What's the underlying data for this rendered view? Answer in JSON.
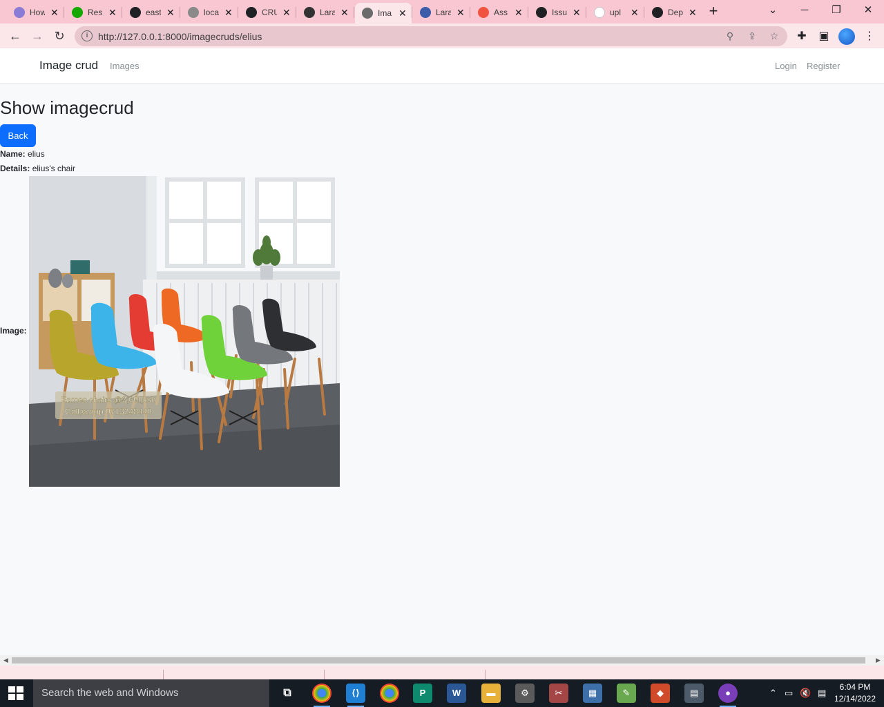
{
  "browser": {
    "tabs": [
      {
        "title": "How",
        "favicon_color": "#8a7bd6"
      },
      {
        "title": "Res",
        "favicon_color": "#14a800"
      },
      {
        "title": "east",
        "favicon_color": "#202124"
      },
      {
        "title": "loca",
        "favicon_color": "#8a8a8a"
      },
      {
        "title": "CRU",
        "favicon_color": "#202124"
      },
      {
        "title": "Lara",
        "favicon_color": "#333333"
      },
      {
        "title": "Ima",
        "favicon_color": "#6b6b6b"
      },
      {
        "title": "Lara",
        "favicon_color": "#3c5ba8"
      },
      {
        "title": "Ass",
        "favicon_color": "#f05340"
      },
      {
        "title": "Issu",
        "favicon_color": "#202124"
      },
      {
        "title": "upl",
        "favicon_color": "#ffffff"
      },
      {
        "title": "Dep",
        "favicon_color": "#202124"
      }
    ],
    "active_tab_index": 6,
    "url": "http://127.0.0.1:8000/imagecruds/elius",
    "colors": {
      "tabstrip": "#f9c7d2",
      "toolbar": "#fbe6ea",
      "omnibox": "#e9c7cf"
    }
  },
  "navbar": {
    "brand": "Image crud",
    "links": [
      "Images"
    ],
    "auth_links": [
      "Login",
      "Register"
    ]
  },
  "page": {
    "title": "Show imagecrud",
    "back_label": "Back",
    "name_label": "Name:",
    "name_value": "elius",
    "details_label": "Details:",
    "details_value": "elius's chair",
    "image_label": "Image:",
    "image_caption_line1": "Eames chairs @3,000ksh",
    "image_caption_line2": "Call,w.app 0713248440",
    "accent_color": "#0d6efd"
  },
  "taskbar": {
    "search_placeholder": "Search the web and Windows",
    "time": "6:04 PM",
    "date": "12/14/2022"
  }
}
